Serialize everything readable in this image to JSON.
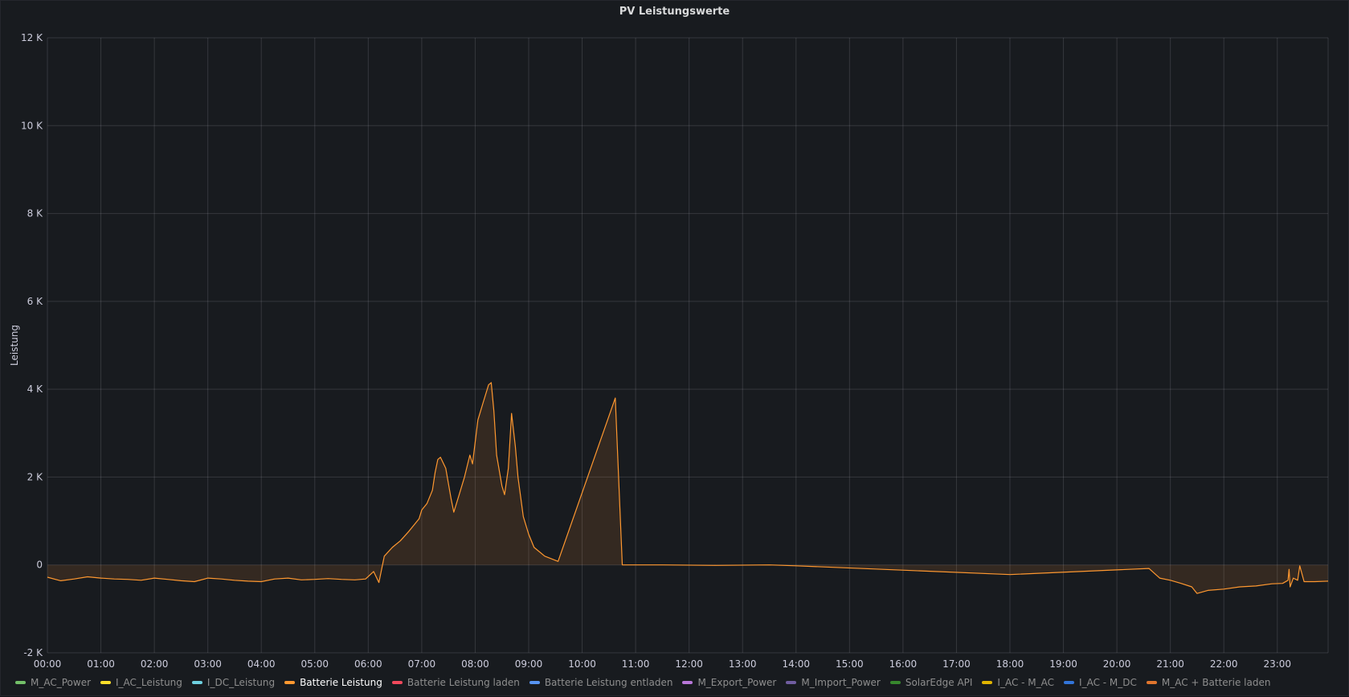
{
  "panel": {
    "title": "PV Leistungswerte"
  },
  "chart_data": {
    "type": "area",
    "ylabel": "Leistung",
    "ylim": [
      -2000,
      12000
    ],
    "xlim": [
      0,
      23.95
    ],
    "y_ticks": [
      {
        "value": 12000,
        "label": "12 K"
      },
      {
        "value": 10000,
        "label": "10 K"
      },
      {
        "value": 8000,
        "label": "8 K"
      },
      {
        "value": 6000,
        "label": "6 K"
      },
      {
        "value": 4000,
        "label": "4 K"
      },
      {
        "value": 2000,
        "label": "2 K"
      },
      {
        "value": 0,
        "label": "0"
      },
      {
        "value": -2000,
        "label": "-2 K"
      }
    ],
    "x_ticks": [
      "00:00",
      "01:00",
      "02:00",
      "03:00",
      "04:00",
      "05:00",
      "06:00",
      "07:00",
      "08:00",
      "09:00",
      "10:00",
      "11:00",
      "12:00",
      "13:00",
      "14:00",
      "15:00",
      "16:00",
      "17:00",
      "18:00",
      "19:00",
      "20:00",
      "21:00",
      "22:00",
      "23:00"
    ],
    "grid": true,
    "series": [
      {
        "name": "Batterie Leistung",
        "color": "#ff9830",
        "x": [
          0.0,
          0.25,
          0.5,
          0.75,
          1.0,
          1.25,
          1.5,
          1.75,
          2.0,
          2.25,
          2.5,
          2.75,
          3.0,
          3.25,
          3.5,
          3.75,
          4.0,
          4.25,
          4.5,
          4.75,
          5.0,
          5.25,
          5.5,
          5.75,
          5.95,
          6.1,
          6.2,
          6.3,
          6.45,
          6.6,
          6.75,
          6.85,
          6.95,
          7.0,
          7.1,
          7.2,
          7.25,
          7.3,
          7.35,
          7.45,
          7.55,
          7.6,
          7.7,
          7.8,
          7.9,
          7.95,
          8.05,
          8.15,
          8.25,
          8.3,
          8.35,
          8.4,
          8.5,
          8.55,
          8.62,
          8.68,
          8.75,
          8.8,
          8.9,
          9.0,
          9.1,
          9.3,
          9.55,
          10.62,
          10.75,
          11.5,
          12.5,
          13.5,
          14.0,
          18.0,
          20.6,
          20.8,
          21.0,
          21.2,
          21.4,
          21.5,
          21.7,
          22.0,
          22.3,
          22.6,
          22.9,
          23.1,
          23.2,
          23.22,
          23.24,
          23.3,
          23.38,
          23.42,
          23.5,
          23.7,
          23.95
        ],
        "y": [
          -280,
          -360,
          -320,
          -270,
          -300,
          -320,
          -330,
          -350,
          -300,
          -330,
          -360,
          -380,
          -300,
          -320,
          -350,
          -370,
          -380,
          -320,
          -300,
          -340,
          -330,
          -310,
          -330,
          -340,
          -320,
          -150,
          -400,
          200,
          400,
          550,
          750,
          900,
          1050,
          1250,
          1400,
          1700,
          2100,
          2400,
          2450,
          2200,
          1500,
          1200,
          1600,
          2000,
          2500,
          2300,
          3300,
          3700,
          4100,
          4150,
          3500,
          2500,
          1800,
          1600,
          2200,
          3450,
          2700,
          2000,
          1100,
          700,
          400,
          200,
          80,
          3800,
          0,
          0,
          -10,
          0,
          -20,
          -220,
          -80,
          -300,
          -350,
          -420,
          -500,
          -650,
          -580,
          -550,
          -500,
          -480,
          -430,
          -420,
          -350,
          -100,
          -500,
          -300,
          -350,
          -20,
          -380,
          -380,
          -370
        ]
      }
    ],
    "legend": {
      "placement": "bottom-left",
      "items": [
        {
          "name": "M_AC_Power",
          "color": "#73bf69",
          "active": false
        },
        {
          "name": "I_AC_Leistung",
          "color": "#fade2a",
          "active": false
        },
        {
          "name": "I_DC_Leistung",
          "color": "#6ed0e0",
          "active": false
        },
        {
          "name": "Batterie Leistung",
          "color": "#ff9830",
          "active": true
        },
        {
          "name": "Batterie Leistung laden",
          "color": "#f2495c",
          "active": false
        },
        {
          "name": "Batterie Leistung entladen",
          "color": "#5794f2",
          "active": false
        },
        {
          "name": "M_Export_Power",
          "color": "#b877d9",
          "active": false
        },
        {
          "name": "M_Import_Power",
          "color": "#705da0",
          "active": false
        },
        {
          "name": "SolarEdge API",
          "color": "#37872d",
          "active": false
        },
        {
          "name": "I_AC - M_AC",
          "color": "#e0b400",
          "active": false
        },
        {
          "name": "I_AC - M_DC",
          "color": "#3274d9",
          "active": false
        },
        {
          "name": "M_AC + Batterie laden",
          "color": "#e0752d",
          "active": false
        }
      ]
    }
  }
}
